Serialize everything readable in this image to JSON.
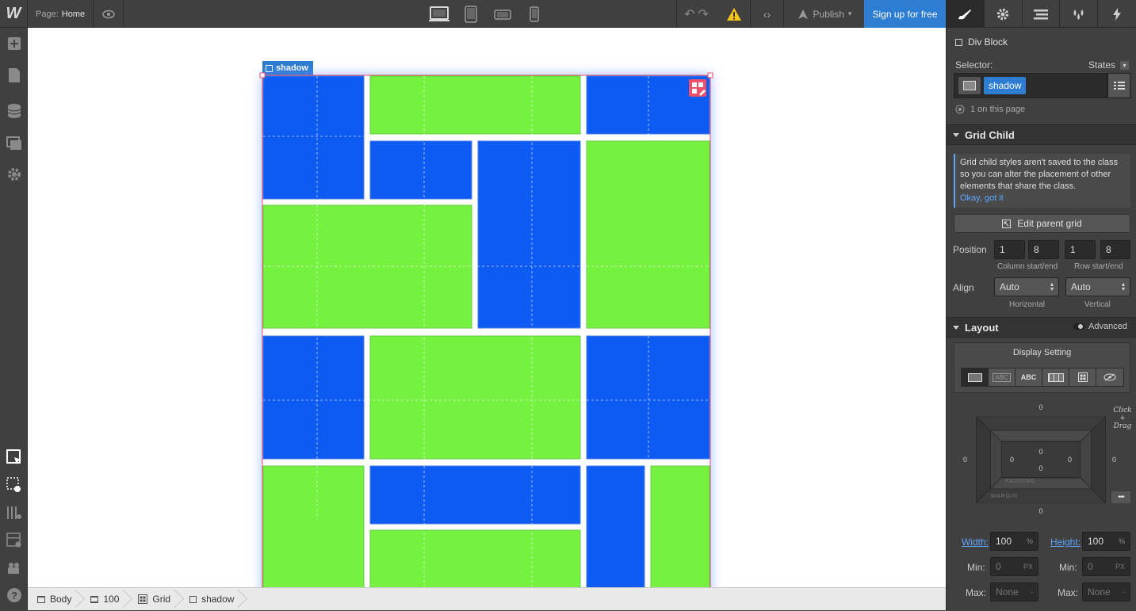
{
  "topbar": {
    "logo": "W",
    "page_label": "Page:",
    "page_name": "Home",
    "publish_label": "Publish",
    "signup_label": "Sign up for free"
  },
  "canvas": {
    "selected_tag": "shadow",
    "colors": {
      "green": "#74f23f",
      "blue": "#0d5bf2",
      "accent": "#ee4f6b"
    }
  },
  "breadcrumbs": [
    {
      "icon": "box-icon",
      "label": "Body"
    },
    {
      "icon": "container-icon",
      "label": "100"
    },
    {
      "icon": "grid-icon",
      "label": "Grid"
    },
    {
      "icon": "div-icon",
      "label": "shadow"
    }
  ],
  "panel": {
    "element_type": "Div Block",
    "selector_label": "Selector:",
    "states_label": "States",
    "selector_chip": "shadow",
    "on_page": "1 on this page",
    "grid_child": {
      "title": "Grid Child",
      "notice": "Grid child styles aren't saved to the class so you can alter the placement of other elements that share the class.",
      "notice_link": "Okay, got it",
      "edit_parent": "Edit parent grid",
      "position_label": "Position",
      "col_start": "1",
      "col_end": "8",
      "row_start": "1",
      "row_end": "8",
      "col_caption": "Column start/end",
      "row_caption": "Row start/end",
      "align_label": "Align",
      "horizontal": "Auto",
      "vertical": "Auto",
      "horizontal_caption": "Horizontal",
      "vertical_caption": "Vertical"
    },
    "layout": {
      "title": "Layout",
      "advanced": "Advanced",
      "display_setting": "Display Setting",
      "margin_top": "0",
      "margin_bottom": "0",
      "margin_left": "0",
      "margin_right": "0",
      "padding_top": "0",
      "padding_bottom": "0",
      "padding_left": "0",
      "padding_right": "0",
      "padding_label": "PADDING",
      "margin_label": "MARGIN",
      "hint": "Click + Drag",
      "width_label": "Width:",
      "width": "100",
      "width_unit": "%",
      "height_label": "Height:",
      "height": "100",
      "height_unit": "%",
      "min_label": "Min:",
      "min_w": "0",
      "min_w_unit": "PX",
      "min_h": "0",
      "min_h_unit": "PX",
      "max_label": "Max:",
      "max_w": "None",
      "max_h": "None",
      "max_unit": "-"
    }
  }
}
